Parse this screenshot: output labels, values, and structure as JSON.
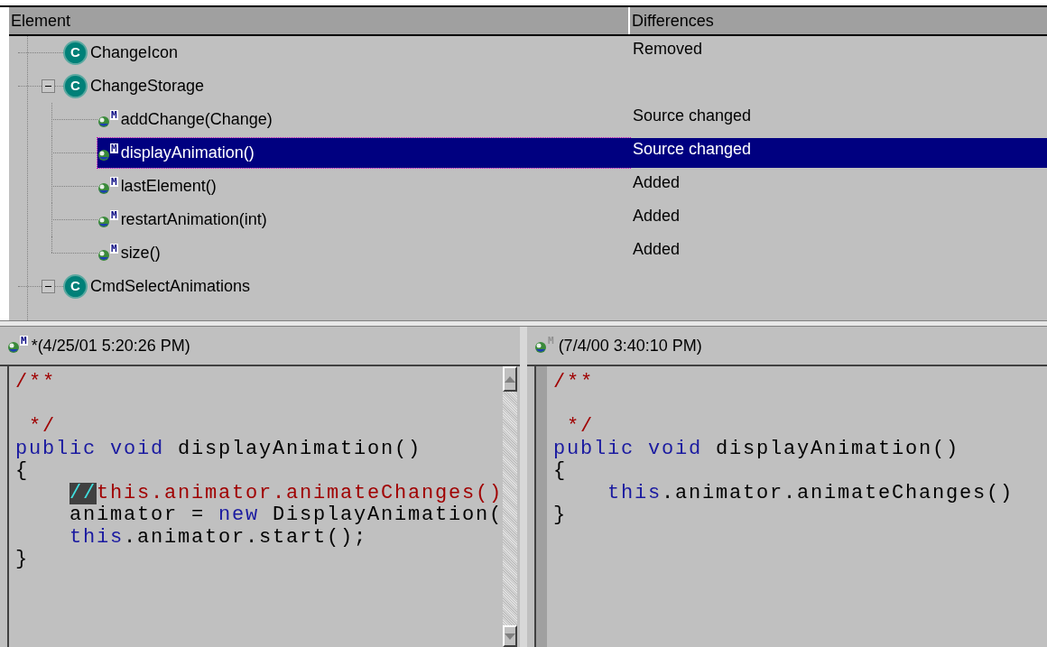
{
  "columns": [
    {
      "label": "Element"
    },
    {
      "label": "Differences"
    }
  ],
  "tree": [
    {
      "name": "ChangeIcon",
      "badge": "C",
      "kind": "class",
      "difference": "Removed",
      "selected": false
    },
    {
      "name": "ChangeStorage",
      "badge": "C",
      "kind": "class",
      "expanded": true,
      "selected": false,
      "children": [
        {
          "name": "addChange(Change)",
          "badge": "M",
          "kind": "method",
          "difference": "Source changed",
          "selected": false
        },
        {
          "name": "displayAnimation()",
          "badge": "M",
          "kind": "method",
          "difference": "Source changed",
          "selected": true
        },
        {
          "name": "lastElement()",
          "badge": "M",
          "kind": "method",
          "difference": "Added",
          "selected": false
        },
        {
          "name": "restartAnimation(int)",
          "badge": "M",
          "kind": "method",
          "difference": "Added",
          "selected": false
        },
        {
          "name": "size()",
          "badge": "M",
          "kind": "method",
          "difference": "Added",
          "selected": false
        }
      ]
    },
    {
      "name": "CmdSelectAnimations",
      "badge": "C",
      "kind": "class",
      "expanded": true,
      "selected": false
    }
  ],
  "panes": [
    {
      "badge": "M",
      "dimmed": false,
      "title": "*(4/25/01 5:20:26 PM)",
      "scrollbar": true,
      "lines": [
        [
          {
            "kind": "comment",
            "text": "/**\n\n */"
          }
        ],
        [
          {
            "kind": "keyword",
            "text": "public void"
          },
          {
            "kind": "plain",
            "text": " displayAnimation()"
          }
        ],
        [
          {
            "kind": "plain",
            "text": "{"
          }
        ],
        [
          {
            "kind": "marked",
            "text": "    //"
          },
          {
            "kind": "comment",
            "text": "this.animator.animateChanges()"
          }
        ],
        [
          {
            "kind": "plain",
            "text": "    animator = "
          },
          {
            "kind": "keyword",
            "text": "new"
          },
          {
            "kind": "plain",
            "text": " DisplayAnimation("
          }
        ],
        [
          {
            "kind": "keyword",
            "text": "    this"
          },
          {
            "kind": "plain",
            "text": ".animator.start();"
          }
        ],
        [
          {
            "kind": "plain",
            "text": "}"
          }
        ]
      ]
    },
    {
      "badge": "M",
      "dimmed": true,
      "title": "(7/4/00 3:40:10 PM)",
      "scrollbar": false,
      "lines": [
        [
          {
            "kind": "comment",
            "text": "/**\n\n */"
          }
        ],
        [
          {
            "kind": "keyword",
            "text": "public void"
          },
          {
            "kind": "plain",
            "text": " displayAnimation()"
          }
        ],
        [
          {
            "kind": "plain",
            "text": "{"
          }
        ],
        [
          {
            "kind": "keyword",
            "text": "    this"
          },
          {
            "kind": "plain",
            "text": ".animator.animateChanges()"
          }
        ],
        [
          {
            "kind": "plain",
            "text": "}"
          }
        ]
      ]
    }
  ]
}
